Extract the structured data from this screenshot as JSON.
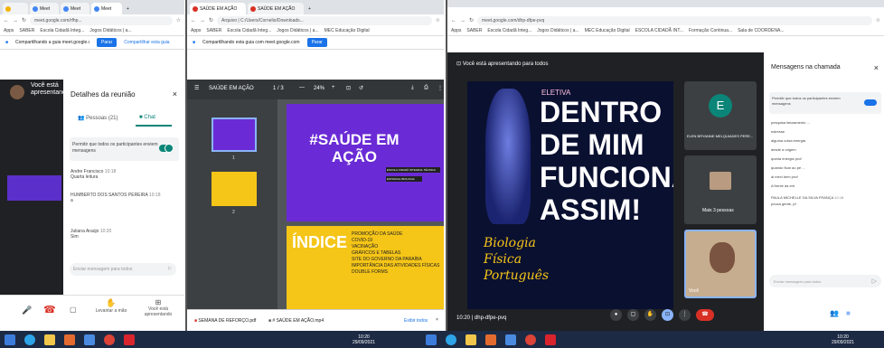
{
  "p1": {
    "tabs": [
      "",
      "Meet",
      "Meet",
      "Meet"
    ],
    "url": "meet.google.com/rfhp...",
    "bookmarks": [
      "Apps",
      "SABER",
      "Escola Cidadã Integ...",
      "Jogos Didáticos | a..."
    ],
    "share_text": "Compartilhando a guia meet.google.com",
    "share_stop": "Parar",
    "share_change": "Compartilhar esta guia",
    "presenting": "Você está apresentando",
    "details_title": "Detalhes da reunião",
    "people_tab": "Pessoas (21)",
    "chat_tab": "Chat",
    "allow_msgs": "Permitir que todos os participantes enviem mensagens",
    "messages": [
      {
        "name": "Andre Francisco",
        "time": "10:18",
        "text": "Quarta leitura"
      },
      {
        "name": "HUMBERTO DOS SANTOS PEREIRA",
        "time": "10:18",
        "text": "a"
      },
      {
        "name": "Juliana Araújo",
        "time": "10:20",
        "text": "Sim"
      }
    ],
    "input_placeholder": "Enviar mensagem para todos",
    "raise_hand": "Levantar a mão",
    "stop_present": "Você está apresentando"
  },
  "p2": {
    "tabs": [
      "SAÚDE EM AÇÃO",
      "SAÚDE EM AÇÃO"
    ],
    "url": "Arquivo | C:/Users/Cornelio/Downloads...",
    "bookmarks": [
      "Apps",
      "SABER",
      "Escola Cidadã Integ...",
      "Jogos Didáticos | a...",
      "MEC Educação Digital"
    ],
    "share_text": "Compartilhando esta guia com meet.google.com",
    "share_stop": "Parar",
    "doc_title": "SAÚDE EM AÇÃO",
    "page": "1 / 3",
    "zoom": "24%",
    "thumb_labels": [
      "1",
      "2"
    ],
    "slide_title": "#SAÚDE EM AÇÃO",
    "slide_small": [
      "ESCOLA CIDADÃ INTEGRAL TÉCNICA",
      "ESTADUAL BIOLOGIA"
    ],
    "indice": "ÍNDICE",
    "indice_items": [
      "PROMOÇÃO DA SAÚDE",
      "COVID-19",
      "VACINAÇÃO",
      "GRÁFICOS E TABELAS",
      "SITE DO GOVERNO DA PARAÍBA",
      "IMPORTÂNCIA DAS ATIVIDADES FÍSICAS",
      "DOUBLE FORMS"
    ],
    "downloads": [
      "SEMANA DE REFORÇO.pdf",
      "# SAÚDE EM AÇÃO.mp4"
    ],
    "show_all": "Exibir todos"
  },
  "p3": {
    "url": "meet.google.com/dhp-dfpe-pvq",
    "bookmarks": [
      "Apps",
      "SABER",
      "Escola Cidadã Integ...",
      "Jogos Didáticos | a...",
      "MEC Educação Digital",
      "ESCOLA CIDADÃ INT...",
      "Formação Continua...",
      "Sala de COORDENA..."
    ],
    "presenting": "Você está apresentando para todos",
    "eletiva": "ELETIVA",
    "slide_title_lines": [
      "DENTRO",
      "DE MIM",
      "FUNCIONA",
      "ASSIM!"
    ],
    "slide_side": [
      "Biologia",
      "Física",
      "Português"
    ],
    "tile_initial": "E",
    "tile_name": "ELEN BRYANNE MELQUIADES PERE...",
    "tile2_name": "Mais 3 pessoas",
    "self_label": "Você",
    "time": "10:20",
    "code": "dhp-dfpe-pvq",
    "chat_title": "Mensagens na chamada",
    "allow_msgs": "Permitir que todos os participantes enviem mensagens",
    "chat_lines": [
      "pesquisa faturamento ...",
      "estresse",
      "alguma coisa energia",
      "desde a origem",
      "queda energia prof",
      "quando ficar ao pé ...",
      "ai mexi bem prof",
      "A frente da ent"
    ],
    "last_sender": "PAULA MICHELLE DA SILVA FRANÇA",
    "last_time": "10:18",
    "last_text": "pouca gente, pf",
    "input_placeholder": "Enviar mensagem para todos"
  },
  "taskbar": {
    "time1": "10:20",
    "date1": "29/09/2021",
    "time2": "10:20",
    "date2": "29/09/2021"
  },
  "colors": {
    "purple": "#6a2bd6",
    "yellow": "#f5c518",
    "meet_dark": "#202124",
    "blue": "#1a73e8",
    "teal": "#0b8578"
  }
}
